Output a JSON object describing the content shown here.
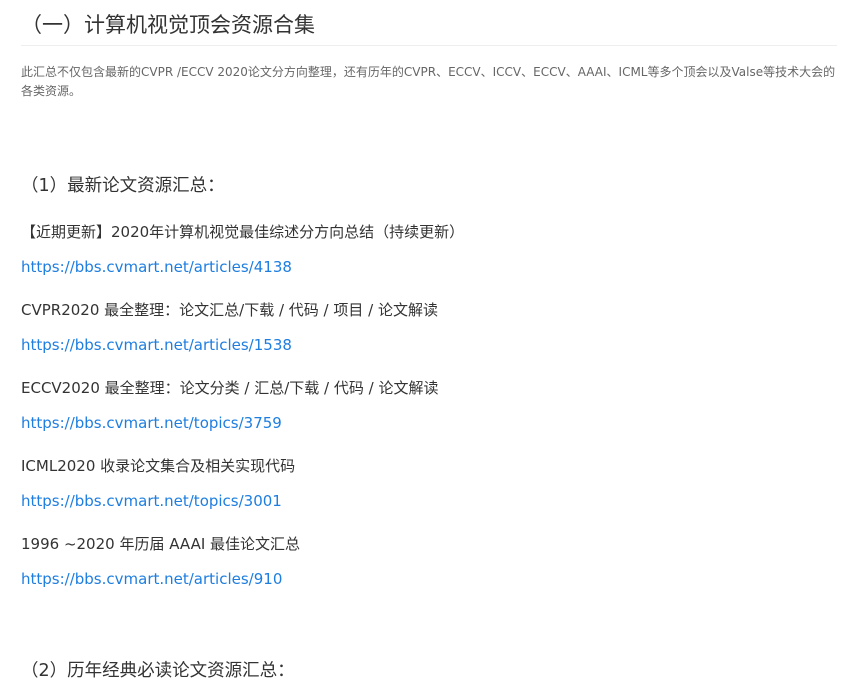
{
  "section": {
    "title": "（一）计算机视觉顶会资源合集",
    "intro": "此汇总不仅包含最新的CVPR /ECCV 2020论文分方向整理，还有历年的CVPR、ECCV、ICCV、ECCV、AAAI、ICML等多个顶会以及Valse等技术大会的各类资源。"
  },
  "subsections": [
    {
      "heading": "（1）最新论文资源汇总：",
      "items": [
        {
          "title": "【近期更新】2020年计算机视觉最佳综述分方向总结（持续更新）",
          "link": "https://bbs.cvmart.net/articles/4138"
        },
        {
          "title": "CVPR2020 最全整理：论文汇总/下载 / 代码 / 项目 / 论文解读",
          "link": "https://bbs.cvmart.net/articles/1538"
        },
        {
          "title": "ECCV2020 最全整理：论文分类 / 汇总/下载 / 代码 / 论文解读",
          "link": "https://bbs.cvmart.net/topics/3759"
        },
        {
          "title": "ICML2020 收录论文集合及相关实现代码",
          "link": "https://bbs.cvmart.net/topics/3001"
        },
        {
          "title": "1996 ~2020 年历届 AAAI 最佳论文汇总",
          "link": "https://bbs.cvmart.net/articles/910"
        }
      ]
    },
    {
      "heading": "（2）历年经典必读论文资源汇总："
    }
  ]
}
